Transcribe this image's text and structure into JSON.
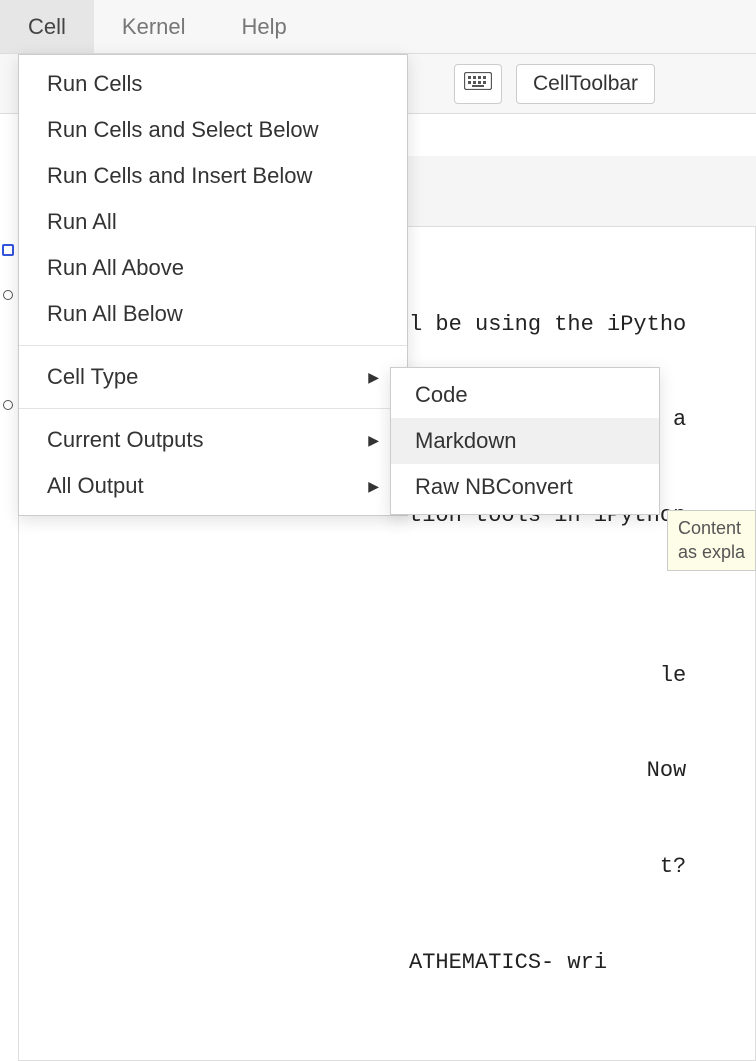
{
  "menubar": {
    "items": [
      "Cell",
      "Kernel",
      "Help"
    ],
    "active_index": 0
  },
  "toolbar": {
    "keyboard_icon": "keyboard-icon",
    "cell_toolbar_label": "CellToolbar"
  },
  "dropdown": {
    "items": [
      {
        "label": "Run Cells",
        "has_submenu": false
      },
      {
        "label": "Run Cells and Select Below",
        "has_submenu": false
      },
      {
        "label": "Run Cells and Insert Below",
        "has_submenu": false
      },
      {
        "label": "Run All",
        "has_submenu": false
      },
      {
        "label": "Run All Above",
        "has_submenu": false
      },
      {
        "label": "Run All Below",
        "has_submenu": false
      }
    ],
    "group2": [
      {
        "label": "Cell Type",
        "has_submenu": true
      }
    ],
    "group3": [
      {
        "label": "Current Outputs",
        "has_submenu": true
      },
      {
        "label": "All Output",
        "has_submenu": true
      }
    ]
  },
  "submenu": {
    "items": [
      "Code",
      "Markdown",
      "Raw NBConvert"
    ],
    "highlight_index": 1
  },
  "notebook": {
    "lines": [
      "l be using the iPytho",
      "r preparing reports a",
      "tion tools in iPython",
      "",
      "                   le",
      "                  Now",
      "                   t?",
      "ATHEMATICS- wri"
    ]
  },
  "tooltip": {
    "line1": "Content",
    "line2": "as expla"
  }
}
